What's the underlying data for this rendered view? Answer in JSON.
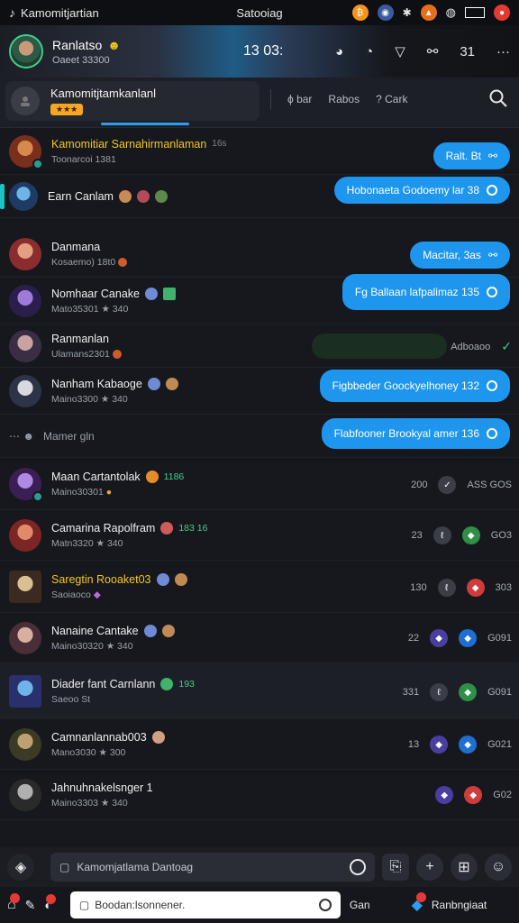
{
  "status": {
    "left_app": "Kamomitjartian",
    "center_title": "Satooiag",
    "colors": {
      "bitcoin": "#f7931a",
      "red": "#e53935"
    }
  },
  "banner": {
    "me_name": "Ranlatso",
    "me_sub": "Oaeet 33300",
    "counter": "13 03:",
    "tool_icons": [
      "discord-icon",
      "clock-icon",
      "inbox-icon",
      "link-icon",
      "grid-icon",
      "more-icon"
    ],
    "count_label": "31"
  },
  "tabs": {
    "active_title": "Kamomitjtamkanlanl",
    "active_badge": "★★★",
    "filter_1": "bar",
    "filter_2": "Rabos",
    "filter_3": "Cark"
  },
  "rows": [
    {
      "name": "Kamomitiar Sarnahirmanlaman",
      "sub": "Toonarcoi 1381",
      "gold": true,
      "bubble": "Ralt. Bt",
      "time": "16s"
    },
    {
      "name": "Earn Canlam",
      "sub": "",
      "bubble": "Hobonaeta Godoemy lar 38"
    },
    {
      "name": "Danmana",
      "sub": "Kosaemo) 18t0",
      "bubble": "Macitar, 3as"
    },
    {
      "name": "Nomhaar Canake",
      "sub": "Mato35301 ★ 340",
      "bubble": "Fg Ballaan lafpalimaz 135"
    },
    {
      "name": "Ranmanlan",
      "sub": "Ulamans2301",
      "meta": "Adboaoo"
    },
    {
      "name": "Nanham Kabaoge",
      "sub": "Maino3300 ★ 340",
      "bubble": "Figbbeder Goockyelhoney 132"
    },
    {
      "name": "Mamer gln",
      "sub": "",
      "bubble": "Flabfooner Brookyal amer 136"
    },
    {
      "name": "Maan Cartantolak",
      "sub": "Maino30301",
      "tag": "1186",
      "time": "200",
      "meta": "ASS GOS"
    },
    {
      "name": "Camarina Rapolfram",
      "sub": "Matn3320 ★ 340",
      "tag": "183 16",
      "time": "23",
      "meta": "GO3"
    },
    {
      "name": "Saregtin Rooaket03",
      "sub": "Saoiaoco",
      "gold": true,
      "time": "130",
      "meta": "303"
    },
    {
      "name": "Nanaine Cantake",
      "sub": "Maino30320 ★ 340",
      "time": "22",
      "meta": "G091"
    },
    {
      "name": "Diader fant Carnlann",
      "sub": "Saeoo St",
      "tag": "193",
      "time": "331",
      "meta": "G091"
    },
    {
      "name": "Camnanlannab003",
      "sub": "Mano3030 ★ 300",
      "time": "13",
      "meta": "G021"
    },
    {
      "name": "Jahnuhnakelsnger 1",
      "sub": "Maino3303 ★ 340",
      "meta": "G02"
    }
  ],
  "typing": "Mamer gln",
  "composer": {
    "placeholder": "Kamomjatlama Dantoag"
  },
  "bottom": {
    "reply_placeholder": "Boodan:lsonnener.",
    "gen_label": "Gan",
    "right_label": "Ranbngiaat"
  }
}
